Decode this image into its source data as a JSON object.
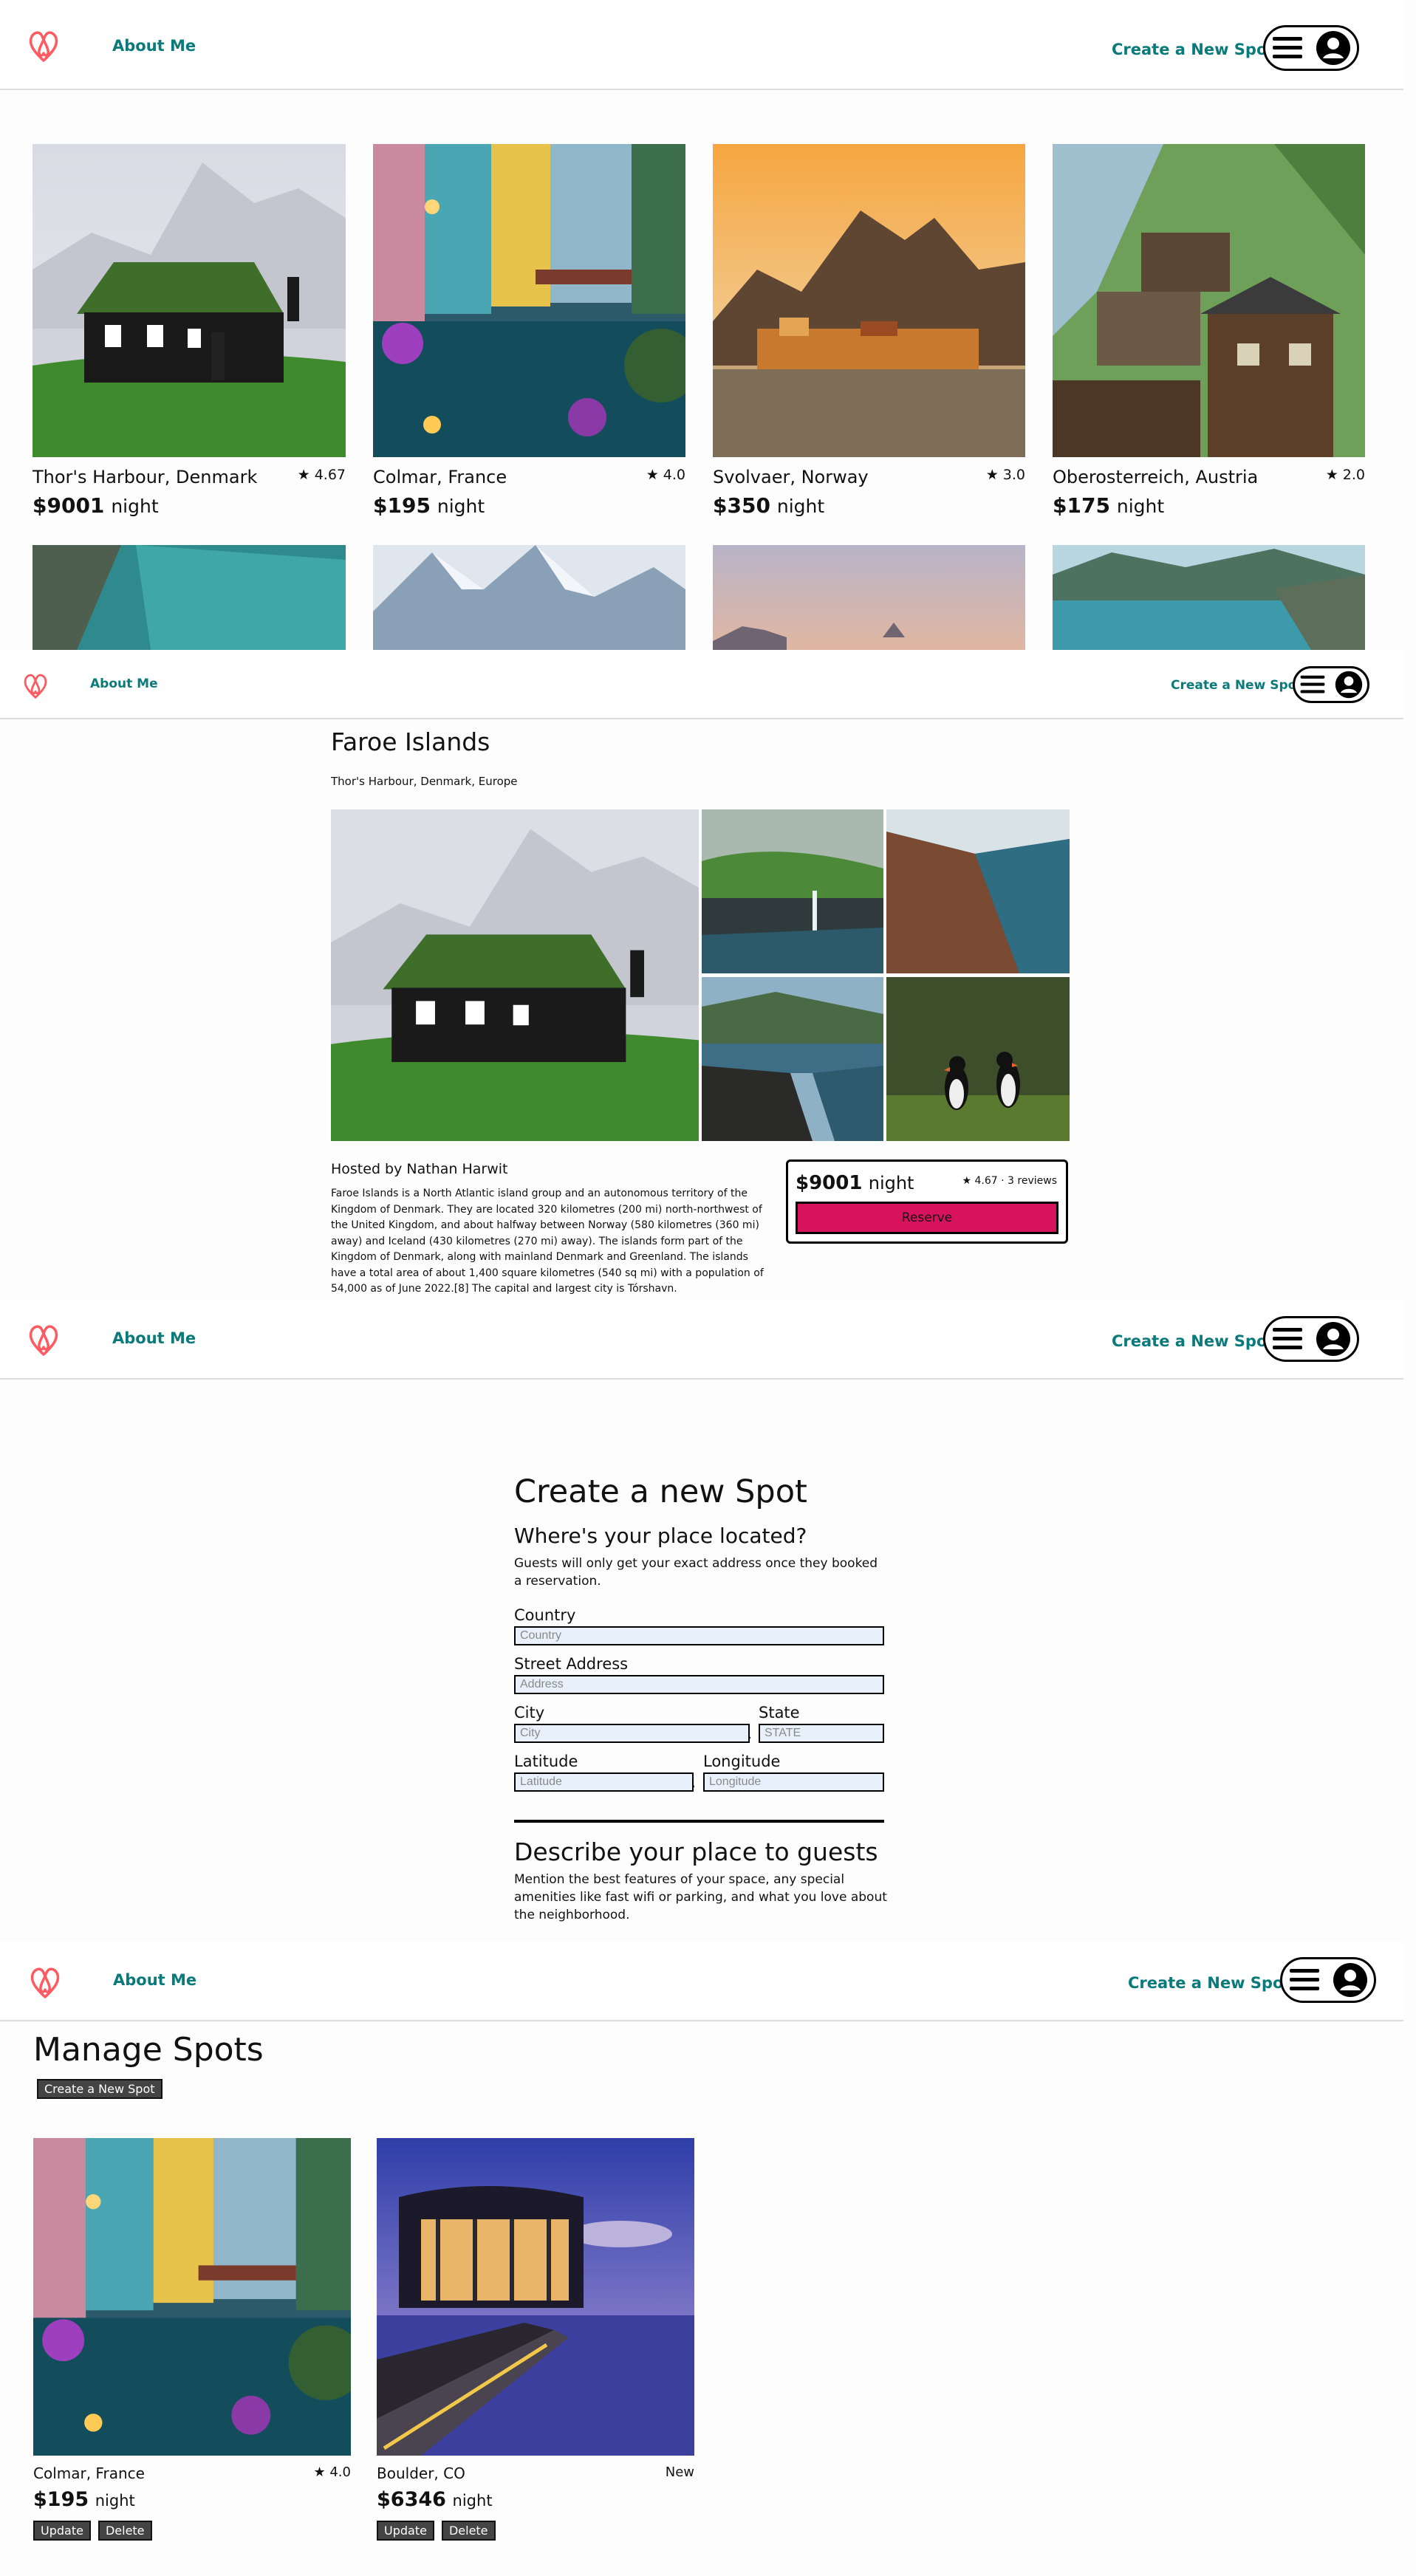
{
  "nav": {
    "about_label": "About Me",
    "create_label": "Create a New Spot"
  },
  "home": {
    "spots": [
      {
        "title": "Thor's Harbour, Denmark",
        "rating": "4.67",
        "price": "$9001",
        "night": "night"
      },
      {
        "title": "Colmar, France",
        "rating": "4.0",
        "price": "$195",
        "night": "night"
      },
      {
        "title": "Svolvaer, Norway",
        "rating": "3.0",
        "price": "$350",
        "night": "night"
      },
      {
        "title": "Oberosterreich, Austria",
        "rating": "2.0",
        "price": "$175",
        "night": "night"
      }
    ]
  },
  "detail": {
    "name": "Faroe Islands",
    "location": "Thor's Harbour, Denmark, Europe",
    "hosted_by": "Hosted by Nathan Harwit",
    "description": "Faroe Islands is a North Atlantic island group and an autonomous territory of the Kingdom of Denmark. They are located 320 kilometres (200 mi) north-northwest of the United Kingdom, and about halfway between Norway (580 kilometres (360 mi) away) and Iceland (430 kilometres (270 mi) away). The islands form part of the Kingdom of Denmark, along with mainland Denmark and Greenland. The islands have a total area of about 1,400 square kilometres (540 sq mi) with a population of 54,000 as of June 2022.[8] The capital and largest city is Tórshavn.",
    "price": "$9001",
    "night": "night",
    "rating_reviews": "4.67 · 3 reviews",
    "reserve_label": "Reserve"
  },
  "create_form": {
    "heading": "Create a new Spot",
    "section1_title": "Where's your place located?",
    "section1_text": "Guests will only get your exact address once they booked a reservation.",
    "country_label": "Country",
    "country_placeholder": "Country",
    "street_label": "Street Address",
    "street_placeholder": "Address",
    "city_label": "City",
    "city_placeholder": "City",
    "state_label": "State",
    "state_placeholder": "STATE",
    "lat_label": "Latitude",
    "lat_placeholder": "Latitude",
    "lng_label": "Longitude",
    "lng_placeholder": "Longitude",
    "comma": ",",
    "section2_title": "Describe your place to guests",
    "section2_text": "Mention the best features of your space, any special amenities like fast wifi or parking, and what you love about the neighborhood."
  },
  "manage": {
    "heading": "Manage Spots",
    "create_btn": "Create a New Spot",
    "spots": [
      {
        "title": "Colmar, France",
        "rating": "4.0",
        "price": "$195",
        "night": "night"
      },
      {
        "title": "Boulder, CO",
        "rating": "New",
        "price": "$6346",
        "night": "night"
      }
    ],
    "update_label": "Update",
    "delete_label": "Delete"
  },
  "colors": {
    "brand": "#ff5a5f",
    "link": "#0b7a7a",
    "reserve": "#d8135e"
  }
}
